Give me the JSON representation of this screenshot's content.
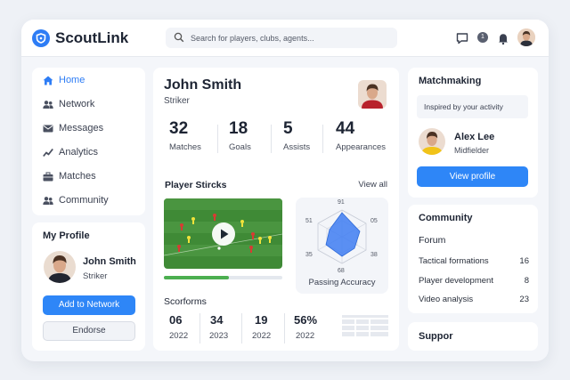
{
  "app": {
    "name": "ScoutLink"
  },
  "search": {
    "placeholder": "Search for players, clubs, agents..."
  },
  "topbar": {
    "notification_count": "1"
  },
  "sidebar": {
    "items": [
      {
        "label": "Home",
        "icon": "home-icon",
        "active": true
      },
      {
        "label": "Network",
        "icon": "people-icon",
        "active": false
      },
      {
        "label": "Messages",
        "icon": "mail-icon",
        "active": false
      },
      {
        "label": "Analytics",
        "icon": "chart-icon",
        "active": false
      },
      {
        "label": "Matches",
        "icon": "briefcase-icon",
        "active": false
      },
      {
        "label": "Community",
        "icon": "people-icon",
        "active": false
      }
    ]
  },
  "my_profile": {
    "title": "My Profile",
    "name": "John Smith",
    "role": "Striker",
    "add_button": "Add to Network",
    "endorse_button": "Endorse"
  },
  "player": {
    "name": "John Smith",
    "position": "Striker",
    "stats": [
      {
        "value": "32",
        "label": "Matches"
      },
      {
        "value": "18",
        "label": "Goals"
      },
      {
        "value": "5",
        "label": "Assists"
      },
      {
        "value": "44",
        "label": "Appearances"
      }
    ]
  },
  "highlights": {
    "title": "Player Stircks",
    "view_all": "View all",
    "video_progress": 0.55,
    "radar": {
      "labels": [
        "91",
        "05",
        "38",
        "68",
        "35",
        "51"
      ],
      "caption": "Passing Accuracy"
    },
    "scorforms": {
      "title": "Scorforms",
      "items": [
        {
          "value": "06",
          "year": "2022"
        },
        {
          "value": "34",
          "year": "2023"
        },
        {
          "value": "19",
          "year": "2022"
        },
        {
          "value": "56%",
          "year": "2022"
        }
      ]
    }
  },
  "matchmaking": {
    "title": "Matchmaking",
    "subtitle": "Inspired by your activity",
    "name": "Alex Lee",
    "role": "Midfielder",
    "button": "View profile"
  },
  "community": {
    "title": "Community",
    "forum_title": "Forum",
    "rows": [
      {
        "label": "Tactical formations",
        "count": "16"
      },
      {
        "label": "Player development",
        "count": "8"
      },
      {
        "label": "Video analysis",
        "count": "23"
      }
    ]
  },
  "support": {
    "title": "Suppor"
  },
  "colors": {
    "accent": "#2e7df5",
    "button": "#2e86f7",
    "pitch": "#3f8a36"
  }
}
